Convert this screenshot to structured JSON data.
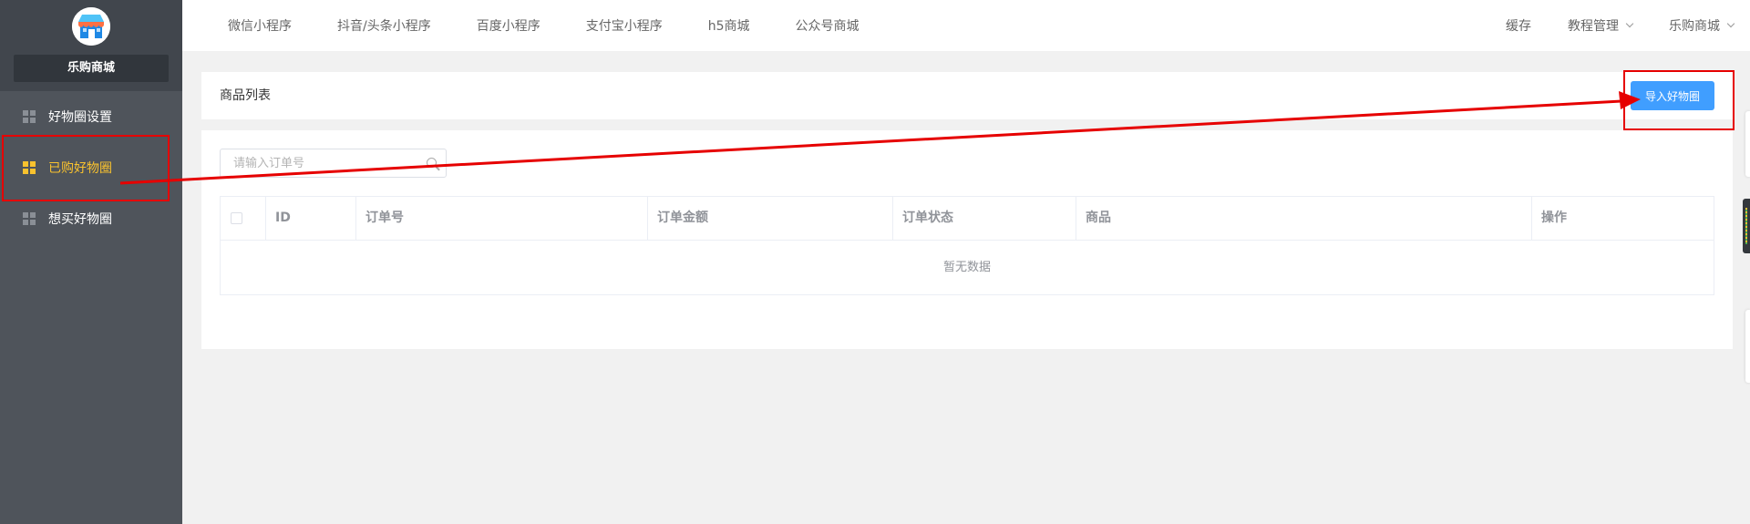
{
  "sidebar": {
    "store_name": "乐购商城",
    "items": [
      {
        "label": "好物圈设置",
        "active": false
      },
      {
        "label": "已购好物圈",
        "active": true
      },
      {
        "label": "想买好物圈",
        "active": false
      }
    ]
  },
  "topnav": {
    "links": [
      "微信小程序",
      "抖音/头条小程序",
      "百度小程序",
      "支付宝小程序",
      "h5商城",
      "公众号商城"
    ],
    "cache_label": "缓存",
    "tutorial_label": "教程管理",
    "store_menu_label": "乐购商城"
  },
  "page": {
    "title": "商品列表",
    "import_button": "导入好物圈",
    "search_placeholder": "请输入订单号"
  },
  "table": {
    "columns": [
      "ID",
      "订单号",
      "订单金额",
      "订单状态",
      "商品",
      "操作"
    ],
    "empty_text": "暂无数据"
  },
  "colors": {
    "sidebar_bg": "#4f545b",
    "active_menu": "#f9c22e",
    "primary": "#409eff",
    "annotation": "#e60000"
  },
  "icons": [
    "store-logo-icon",
    "grid-icon",
    "chevron-down-icon",
    "search-icon",
    "checkbox-icon"
  ]
}
